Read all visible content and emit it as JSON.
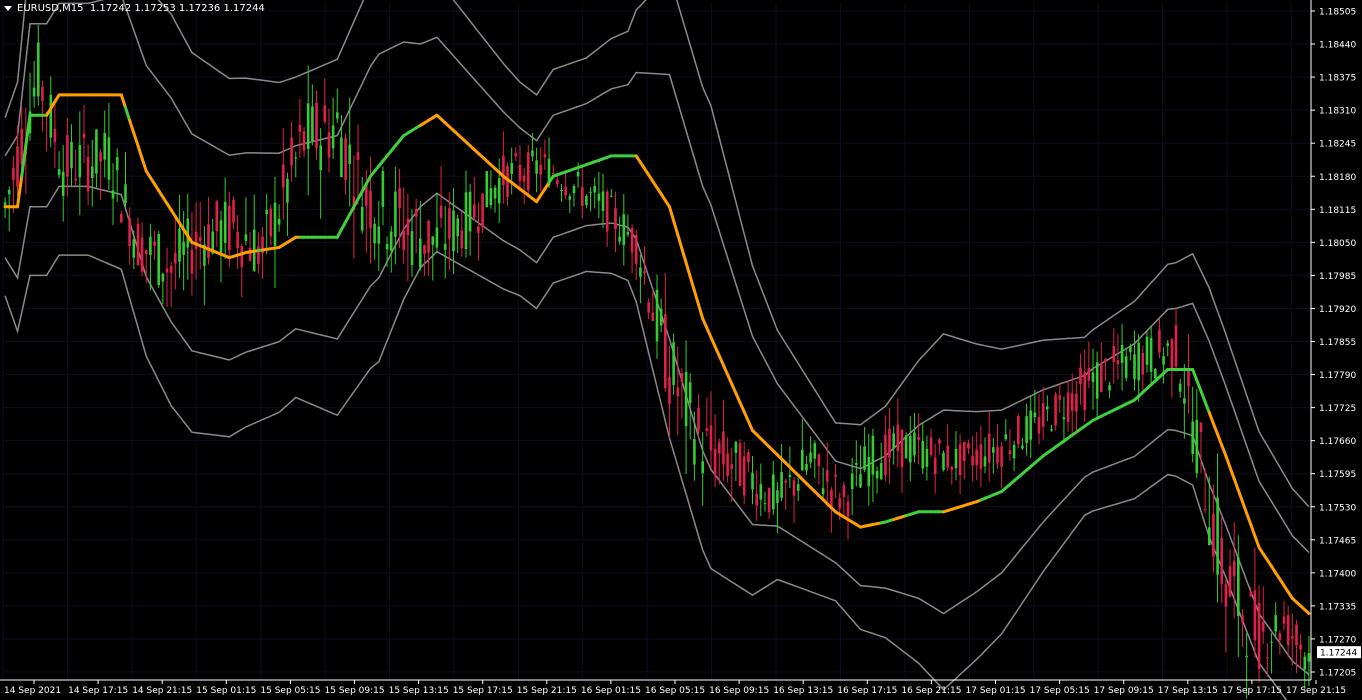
{
  "symbol_label": "EURUSD,M15",
  "ohlc": "1.17242 1.17253 1.17236 1.17244",
  "current_price": "1.17244",
  "colors": {
    "background": "#000000",
    "axis": "#ffffff",
    "grid": "#0d0d1f",
    "bull": "#33cc33",
    "bear": "#e0204a",
    "band": "#8a8a8a",
    "ma_up": "#3fd03f",
    "ma_down": "#ff9f00"
  },
  "chart_data": {
    "type": "candlestick",
    "y_ticks": [
      "1.18505",
      "1.18440",
      "1.18375",
      "1.18310",
      "1.18245",
      "1.18180",
      "1.18115",
      "1.18050",
      "1.17985",
      "1.17920",
      "1.17855",
      "1.17790",
      "1.17725",
      "1.17660",
      "1.17595",
      "1.17530",
      "1.17465",
      "1.17400",
      "1.17335",
      "1.17270",
      "1.17205"
    ],
    "ylim": [
      1.17205,
      1.18505
    ],
    "x_ticks": [
      "14 Sep 2021",
      "14 Sep 17:15",
      "14 Sep 21:15",
      "15 Sep 01:15",
      "15 Sep 05:15",
      "15 Sep 09:15",
      "15 Sep 13:15",
      "15 Sep 17:15",
      "15 Sep 21:15",
      "16 Sep 01:15",
      "16 Sep 05:15",
      "16 Sep 09:15",
      "16 Sep 13:15",
      "16 Sep 17:15",
      "16 Sep 21:15",
      "17 Sep 01:15",
      "17 Sep 05:15",
      "17 Sep 09:15",
      "17 Sep 13:15",
      "17 Sep 17:15",
      "17 Sep 21:15"
    ],
    "anchors": [
      [
        0,
        1.1812,
        1.1812,
        1.182,
        1.1798
      ],
      [
        8,
        1.1838,
        1.1824,
        1.1832,
        1.1812
      ],
      [
        14,
        1.182,
        1.1826,
        1.1834,
        1.1814
      ],
      [
        25,
        1.1822,
        1.1824,
        1.1832,
        1.1813
      ],
      [
        32,
        1.1805,
        1.1816,
        1.1827,
        1.1808
      ],
      [
        40,
        1.18,
        1.1805,
        1.1815,
        1.1796
      ],
      [
        47,
        1.1806,
        1.1801,
        1.181,
        1.179
      ],
      [
        55,
        1.1808,
        1.1804,
        1.1812,
        1.1791
      ],
      [
        62,
        1.1803,
        1.1806,
        1.1814,
        1.1793
      ],
      [
        72,
        1.1825,
        1.1808,
        1.1822,
        1.1795
      ],
      [
        80,
        1.1828,
        1.1816,
        1.1826,
        1.18
      ],
      [
        86,
        1.1815,
        1.183,
        1.1838,
        1.1812
      ],
      [
        96,
        1.1808,
        1.183,
        1.1838,
        1.1808
      ],
      [
        104,
        1.1805,
        1.1825,
        1.1831,
        1.1808
      ],
      [
        112,
        1.181,
        1.1818,
        1.1824,
        1.1808
      ],
      [
        120,
        1.1818,
        1.181,
        1.1816,
        1.1804
      ],
      [
        130,
        1.182,
        1.1815,
        1.1819,
        1.1811
      ],
      [
        144,
        1.1812,
        1.1815,
        1.1818,
        1.1808
      ],
      [
        152,
        1.1805,
        1.1813,
        1.1816,
        1.1805
      ],
      [
        160,
        1.178,
        1.1806,
        1.1809,
        1.178
      ],
      [
        168,
        1.1765,
        1.1785,
        1.1788,
        1.1764
      ],
      [
        178,
        1.176,
        1.1768,
        1.1772,
        1.1758
      ],
      [
        186,
        1.1754,
        1.1762,
        1.1766,
        1.1752
      ],
      [
        194,
        1.1762,
        1.1754,
        1.1763,
        1.1748
      ],
      [
        202,
        1.1754,
        1.176,
        1.1763,
        1.1752
      ],
      [
        208,
        1.1762,
        1.1756,
        1.1764,
        1.175
      ],
      [
        216,
        1.1765,
        1.176,
        1.1768,
        1.1756
      ],
      [
        230,
        1.1762,
        1.1764,
        1.1766,
        1.1758
      ],
      [
        240,
        1.1765,
        1.1762,
        1.177,
        1.1759
      ],
      [
        250,
        1.177,
        1.1765,
        1.1772,
        1.1763
      ],
      [
        262,
        1.1778,
        1.177,
        1.1782,
        1.1768
      ],
      [
        272,
        1.1782,
        1.1776,
        1.1786,
        1.1774
      ],
      [
        282,
        1.1784,
        1.178,
        1.1788,
        1.1774
      ],
      [
        286,
        1.177,
        1.1784,
        1.179,
        1.1768
      ],
      [
        294,
        1.1738,
        1.177,
        1.1774,
        1.1735
      ],
      [
        302,
        1.1728,
        1.174,
        1.1744,
        1.1722
      ],
      [
        308,
        1.173,
        1.1728,
        1.1733,
        1.1722
      ],
      [
        314,
        1.1724,
        1.173,
        1.1734,
        1.172
      ]
    ],
    "ma_anchors": [
      [
        0,
        1.1812
      ],
      [
        3,
        1.1812
      ],
      [
        6,
        1.183
      ],
      [
        10,
        1.183
      ],
      [
        13,
        1.1834
      ],
      [
        28,
        1.1834
      ],
      [
        34,
        1.1819
      ],
      [
        45,
        1.1805
      ],
      [
        54,
        1.1802
      ],
      [
        58,
        1.1803
      ],
      [
        66,
        1.1804
      ],
      [
        70,
        1.1806
      ],
      [
        80,
        1.1806
      ],
      [
        88,
        1.1818
      ],
      [
        96,
        1.1826
      ],
      [
        100,
        1.1828
      ],
      [
        104,
        1.183
      ],
      [
        112,
        1.1824
      ],
      [
        120,
        1.1818
      ],
      [
        128,
        1.1813
      ],
      [
        132,
        1.1818
      ],
      [
        146,
        1.1822
      ],
      [
        152,
        1.1822
      ],
      [
        160,
        1.1812
      ],
      [
        168,
        1.179
      ],
      [
        180,
        1.1768
      ],
      [
        190,
        1.176
      ],
      [
        200,
        1.1752
      ],
      [
        206,
        1.1749
      ],
      [
        212,
        1.175
      ],
      [
        220,
        1.1752
      ],
      [
        226,
        1.1752
      ],
      [
        234,
        1.1754
      ],
      [
        240,
        1.1756
      ],
      [
        250,
        1.1763
      ],
      [
        262,
        1.177
      ],
      [
        272,
        1.1774
      ],
      [
        280,
        1.178
      ],
      [
        286,
        1.178
      ],
      [
        294,
        1.1763
      ],
      [
        302,
        1.1745
      ],
      [
        310,
        1.1735
      ],
      [
        314,
        1.1732
      ]
    ],
    "ma_down_ranges": [
      [
        0,
        3
      ],
      [
        10,
        28
      ],
      [
        30,
        60
      ],
      [
        62,
        70
      ],
      [
        100,
        130
      ],
      [
        152,
        210
      ],
      [
        214,
        216
      ],
      [
        226,
        234
      ],
      [
        290,
        314
      ]
    ],
    "band_inner_width": [
      [
        0,
        0.001
      ],
      [
        6,
        0.0018
      ],
      [
        20,
        0.0018
      ],
      [
        40,
        0.0022
      ],
      [
        55,
        0.002
      ],
      [
        70,
        0.0018
      ],
      [
        90,
        0.0022
      ],
      [
        100,
        0.0016
      ],
      [
        124,
        0.0012
      ],
      [
        140,
        0.0012
      ],
      [
        150,
        0.0014
      ],
      [
        160,
        0.0026
      ],
      [
        170,
        0.0026
      ],
      [
        186,
        0.0014
      ],
      [
        200,
        0.001
      ],
      [
        212,
        0.0013
      ],
      [
        226,
        0.002
      ],
      [
        240,
        0.0016
      ],
      [
        260,
        0.001
      ],
      [
        282,
        0.0012
      ],
      [
        290,
        0.0014
      ],
      [
        314,
        0.0012
      ]
    ],
    "band_outer_factor": 1.75
  }
}
